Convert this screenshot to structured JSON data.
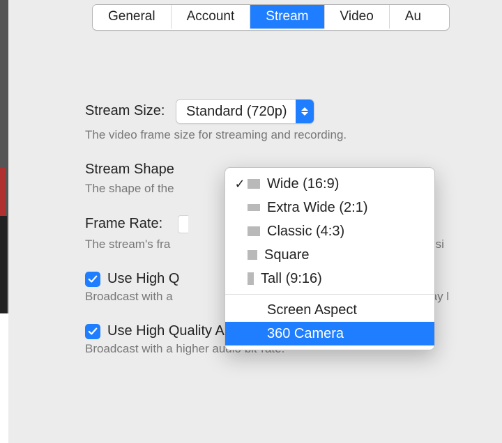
{
  "tabs": {
    "general": "General",
    "account": "Account",
    "stream": "Stream",
    "video": "Video",
    "audio": "Au"
  },
  "stream_size": {
    "label": "Stream Size:",
    "value": "Standard (720p)",
    "help": "The video frame size for streaming and recording."
  },
  "stream_shape": {
    "label": "Stream Shape",
    "help": "The shape of the",
    "menu": {
      "wide": "Wide (16:9)",
      "extra_wide": "Extra Wide (2:1)",
      "classic": "Classic (4:3)",
      "square": "Square",
      "tall": "Tall (9:16)",
      "screen": "Screen Aspect",
      "cam360": "360 Camera",
      "selected": "wide",
      "highlighted": "cam360"
    }
  },
  "frame_rate": {
    "label": "Frame Rate:",
    "help_left": "The stream's fra",
    "help_right": "ote that usi"
  },
  "hq_video": {
    "label": "Use High Q",
    "help_left": "Broadcast with a",
    "help_right": "etting may l"
  },
  "hq_audio": {
    "label": "Use High Quality Audio Mode",
    "help": "Broadcast with a higher audio bit-rate."
  }
}
